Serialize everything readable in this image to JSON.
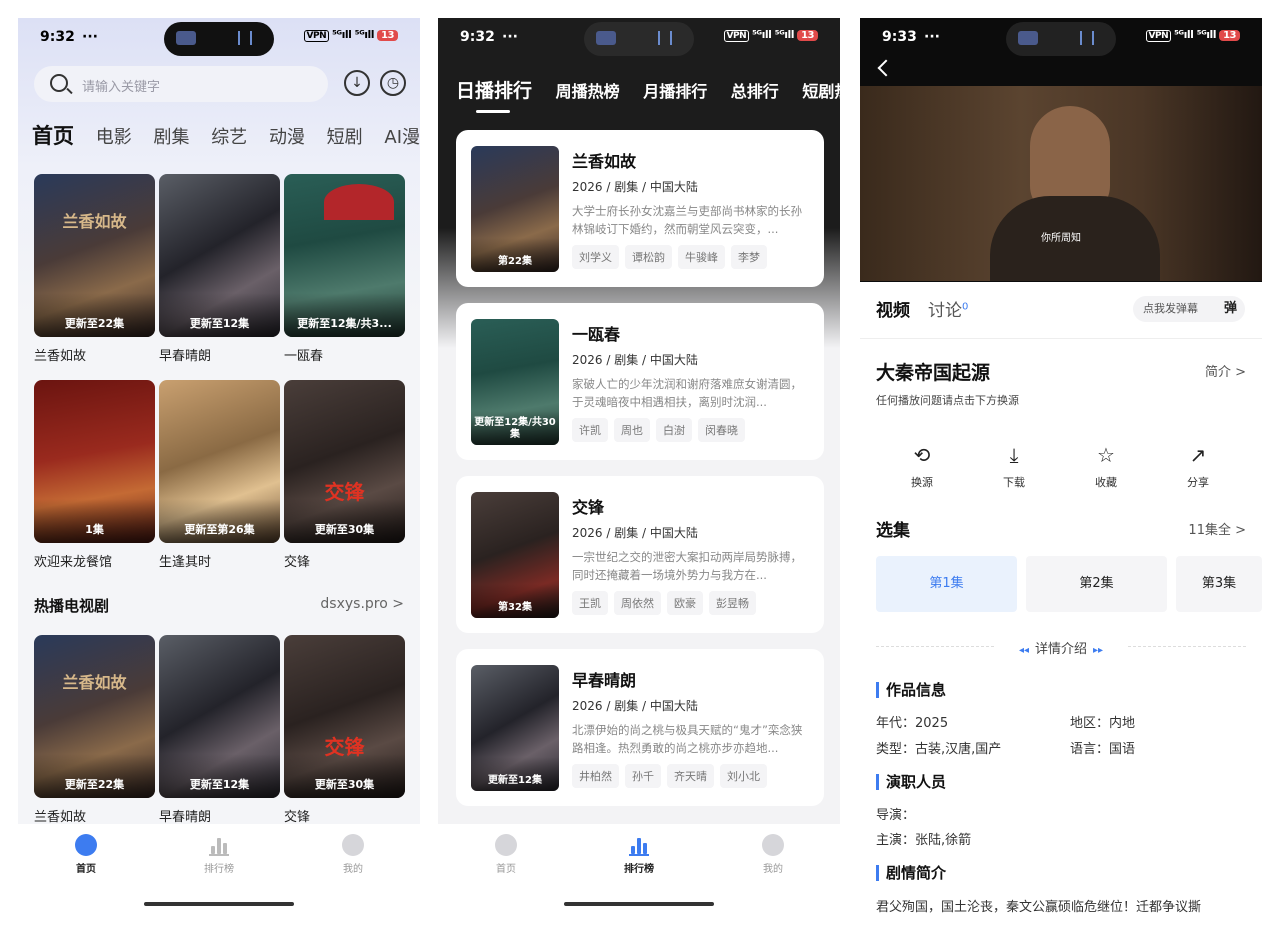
{
  "status_bar": {
    "p1_time": "9:32",
    "p2_time": "9:32",
    "p3_time": "9:33",
    "dots": "···",
    "vpn": "VPN",
    "signal": "⁵ᴳıll ⁵ᴳıll",
    "battery": "13"
  },
  "home": {
    "search_placeholder": "请输入关键字",
    "download_icon": "↓",
    "history_icon": "◷",
    "tabs": [
      "首页",
      "电影",
      "剧集",
      "综艺",
      "动漫",
      "短剧",
      "AI漫剧"
    ],
    "row1": [
      {
        "name": "兰香如故",
        "badge": "更新至22集",
        "poster_title": "兰香如故"
      },
      {
        "name": "早春晴朗",
        "badge": "更新至12集",
        "poster_title": ""
      },
      {
        "name": "一瓯春",
        "badge": "更新至12集/共3...",
        "poster_title": ""
      }
    ],
    "row2": [
      {
        "name": "欢迎来龙餐馆",
        "badge": "1集",
        "poster_title": ""
      },
      {
        "name": "生逢其时",
        "badge": "更新至第26集",
        "poster_title": ""
      },
      {
        "name": "交锋",
        "badge": "更新至30集",
        "poster_title": "交锋"
      }
    ],
    "section_title": "热播电视剧",
    "section_more": "dsxys.pro >",
    "row3": [
      {
        "name": "兰香如故",
        "badge": "更新至22集",
        "poster_title": "兰香如故"
      },
      {
        "name": "早春晴朗",
        "badge": "更新至12集",
        "poster_title": ""
      },
      {
        "name": "交锋",
        "badge": "更新至30集",
        "poster_title": "交锋"
      }
    ]
  },
  "tabbar": {
    "home": "首页",
    "rank": "排行榜",
    "mine": "我的"
  },
  "ranking": {
    "tabs": [
      "日播排行",
      "周播热榜",
      "月播排行",
      "总排行",
      "短剧热"
    ],
    "items": [
      {
        "title": "兰香如故",
        "meta": "2026 / 剧集 / 中国大陆",
        "desc": "大学士府长孙女沈嘉兰与吏部尚书林家的长孙林锦岐订下婚约，然而朝堂风云突变，...",
        "tags": [
          "刘学义",
          "谭松韵",
          "牛骏峰",
          "李梦"
        ],
        "badge": "第22集"
      },
      {
        "title": "一瓯春",
        "meta": "2026 / 剧集 / 中国大陆",
        "desc": "家破人亡的少年沈润和谢府落难庶女谢清圆，于灵魂暗夜中相遇相扶，离别时沈润...",
        "tags": [
          "许凯",
          "周也",
          "白澍",
          "闵春晓"
        ],
        "badge": "更新至12集/共30集"
      },
      {
        "title": "交锋",
        "meta": "2026 / 剧集 / 中国大陆",
        "desc": "一宗世纪之交的泄密大案扣动两岸局势脉搏，同时还掩藏着一场境外势力与我方在...",
        "tags": [
          "王凯",
          "周依然",
          "欧豪",
          "彭昱畅"
        ],
        "badge": "第32集"
      },
      {
        "title": "早春晴朗",
        "meta": "2026 / 剧集 / 中国大陆",
        "desc": "北漂伊始的尚之桃与极具天赋的“鬼才”栾念狭路相逢。热烈勇敢的尚之桃亦步亦趋地...",
        "tags": [
          "井柏然",
          "孙千",
          "齐天晴",
          "刘小北"
        ],
        "badge": "更新至12集"
      }
    ]
  },
  "detail": {
    "video_subtitle": "你所周知",
    "tab_video": "视频",
    "tab_discuss": "讨论",
    "discuss_count": "0",
    "danmu_label": "点我发弹幕",
    "danmu_icon": "弹",
    "title": "大秦帝国起源",
    "intro": "简介 >",
    "hint": "任何播放问题请点击下方换源",
    "actions": [
      {
        "icon": "⟲",
        "label": "换源"
      },
      {
        "icon": "⤓",
        "label": "下载"
      },
      {
        "icon": "☆",
        "label": "收藏"
      },
      {
        "icon": "↗",
        "label": "分享"
      }
    ],
    "episodes_title": "选集",
    "episodes_all": "11集全 >",
    "episodes": [
      "第1集",
      "第2集",
      "第3集"
    ],
    "details_label": "详情介绍",
    "sec_info": "作品信息",
    "year": "年代：2025",
    "region": "地区：内地",
    "genre": "类型：古装,汉唐,国产",
    "lang": "语言：国语",
    "sec_cast": "演职人员",
    "director": "导演：",
    "cast": "主演：张陆,徐箭",
    "sec_plot": "剧情简介",
    "plot": "君父殉国，国土沦丧，秦文公赢硕临危继位！迁都争议撕"
  }
}
